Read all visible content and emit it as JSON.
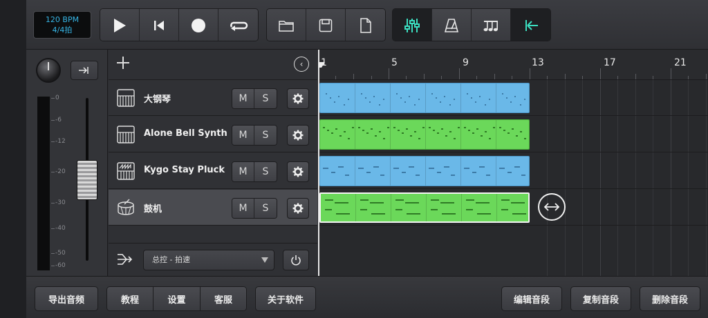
{
  "transport": {
    "bpm": "120 BPM",
    "time_signature": "4/4拍"
  },
  "toolbar": {
    "play_icon": "play-icon",
    "rewind_icon": "skip-to-start-icon",
    "record_icon": "record-icon",
    "loop_icon": "loop-icon",
    "open_icon": "folder-icon",
    "save_icon": "save-icon",
    "new_icon": "new-file-icon",
    "mixer_icon": "mixer-sliders-icon",
    "metronome_icon": "metronome-icon",
    "notes_icon": "music-notes-icon",
    "snap_icon": "snap-to-start-icon",
    "accent_color": "#3bdfc1"
  },
  "mixer": {
    "scale_labels": [
      "0",
      "-6",
      "-12",
      "-20",
      "-30",
      "-40",
      "-50",
      "-60"
    ]
  },
  "tracks": [
    {
      "name": "大钢琴",
      "mute": "M",
      "solo": "S",
      "icon": "piano-icon",
      "color": "blue"
    },
    {
      "name": "Alone Bell Synth",
      "mute": "M",
      "solo": "S",
      "icon": "piano-icon",
      "color": "green"
    },
    {
      "name": "Kygo Stay Pluck",
      "mute": "M",
      "solo": "S",
      "icon": "synth-keyboard-icon",
      "color": "blue"
    },
    {
      "name": "鼓机",
      "mute": "M",
      "solo": "S",
      "icon": "drum-icon",
      "color": "green"
    }
  ],
  "master": {
    "label": "总控 - 拍速"
  },
  "ruler": {
    "bars": [
      "1",
      "5",
      "9",
      "13",
      "17",
      "21"
    ]
  },
  "colors": {
    "blue_region": "#6ab8e8",
    "green_region": "#6bd85a"
  },
  "bottom": {
    "export": "导出音频",
    "tutorial": "教程",
    "settings": "设置",
    "support": "客服",
    "about": "关于软件",
    "edit_clip": "编辑音段",
    "copy_clip": "复制音段",
    "delete_clip": "删除音段"
  }
}
